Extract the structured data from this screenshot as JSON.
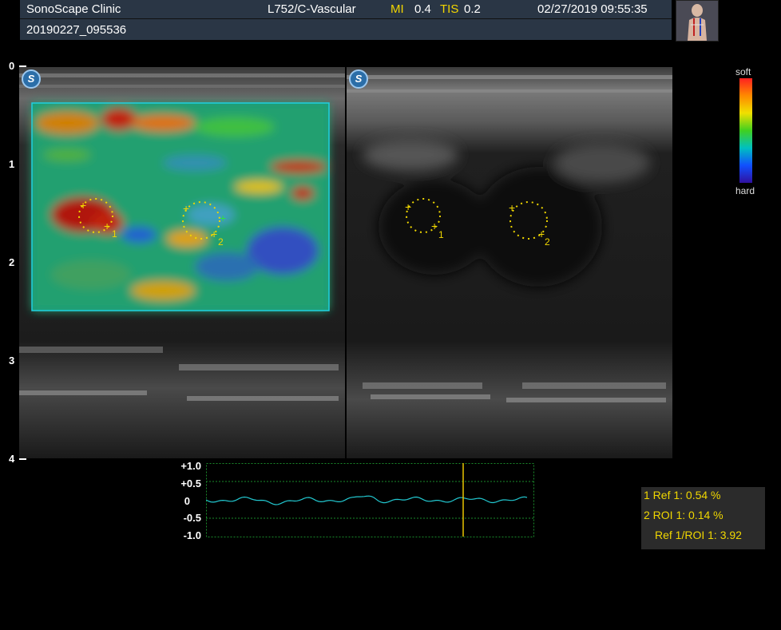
{
  "header": {
    "clinic": "SonoScape Clinic",
    "probe": "L752/C-Vascular",
    "mi_label": "MI",
    "mi_value": "0.4",
    "tis_label": "TIS",
    "tis_value": "0.2",
    "datetime": "02/27/2019 09:55:35",
    "exam_id": "20190227_095536"
  },
  "depth_scale": [
    "0",
    "1",
    "2",
    "3",
    "4"
  ],
  "logo_letter": "S",
  "left_panel": {
    "mode": "elastography-overlay",
    "rois": [
      {
        "label": "1"
      },
      {
        "label": "2"
      }
    ]
  },
  "right_panel": {
    "mode": "b-mode",
    "rois": [
      {
        "label": "1"
      },
      {
        "label": "2"
      }
    ]
  },
  "colorbar": {
    "top_label": "soft",
    "bottom_label": "hard",
    "colors": [
      "#ff2020",
      "#ff8a00",
      "#f0e000",
      "#40d020",
      "#00c0c0",
      "#1050ff",
      "#3010a0"
    ]
  },
  "strain_graph": {
    "y_labels": [
      "+1.0",
      "+0.5",
      "0",
      "-0.5",
      "-1.0"
    ],
    "ylim": [
      -1.0,
      1.0
    ],
    "trace_color": "#22c8d0",
    "cursor_color": "#e8c400"
  },
  "results": {
    "line1": "1  Ref 1: 0.54   %",
    "line2": "2  ROI 1: 0.14   %",
    "line3": "Ref 1/ROI 1: 3.92"
  }
}
